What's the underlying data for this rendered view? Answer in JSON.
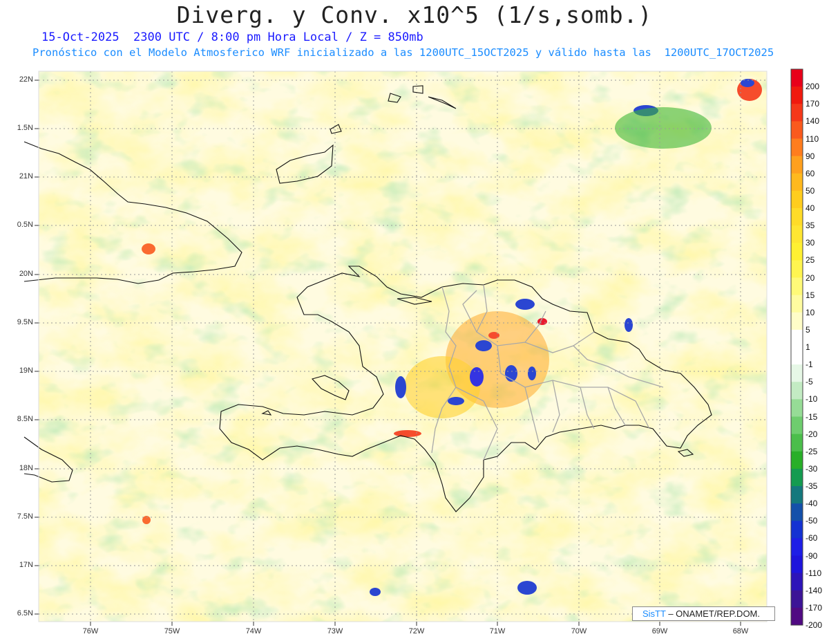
{
  "header": {
    "title": "Diverg. y Conv. x10^5 (1/s,somb.)",
    "subtitle_1": "15-Oct-2025  2300 UTC / 8:00 pm Hora Local / Z = 850mb",
    "subtitle_2": "Pronóstico con el Modelo Atmosferico WRF inicializado a las 1200UTC_15OCT2025 y válido hasta las  1200UTC_17OCT2025"
  },
  "axes": {
    "lat_labels": [
      "22N",
      "1.5N",
      "21N",
      "0.5N",
      "20N",
      "9.5N",
      "19N",
      "8.5N",
      "18N",
      "7.5N",
      "17N",
      "6.5N"
    ],
    "lon_labels": [
      "76W",
      "75W",
      "74W",
      "73W",
      "72W",
      "71W",
      "70W",
      "69W",
      "68W"
    ]
  },
  "colorbar": {
    "labels": [
      "200",
      "170",
      "140",
      "110",
      "90",
      "60",
      "50",
      "40",
      "35",
      "30",
      "25",
      "20",
      "15",
      "10",
      "5",
      "1",
      "-1",
      "-5",
      "-10",
      "-15",
      "-20",
      "-25",
      "-30",
      "-35",
      "-40",
      "-50",
      "-60",
      "-90",
      "-110",
      "-140",
      "-170",
      "-200"
    ],
    "colors": [
      "#e8001a",
      "#f01a0e",
      "#f5381a",
      "#fa5a1e",
      "#ff7d1e",
      "#ffa01e",
      "#ffb91e",
      "#ffcd1e",
      "#ffdc28",
      "#ffe632",
      "#fff032",
      "#fff550",
      "#fffa78",
      "#fffca0",
      "#fffdc8",
      "#ffffff",
      "#ffffff",
      "#e6f7e6",
      "#c3ebc3",
      "#96dc96",
      "#6ecd6e",
      "#4bbe4b",
      "#28af28",
      "#149b50",
      "#14787d",
      "#1450aa",
      "#1432d2",
      "#1e1ee6",
      "#1e14dc",
      "#2d14b9",
      "#3c1496",
      "#500a82"
    ]
  },
  "credit": {
    "logo": "SisTT",
    "text": " – ONAMET/REP.DOM."
  }
}
